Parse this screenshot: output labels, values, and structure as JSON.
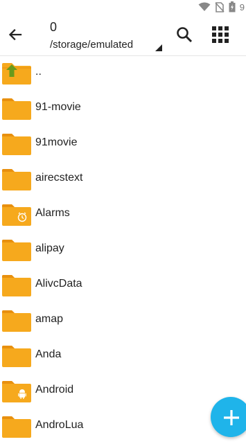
{
  "status_bar": {
    "time": "9"
  },
  "toolbar": {
    "title": "0",
    "path": "/storage/emulated"
  },
  "files": [
    {
      "name": "..",
      "icon": "folder-up-icon"
    },
    {
      "name": "91-movie",
      "icon": "folder-icon"
    },
    {
      "name": "91movie",
      "icon": "folder-icon"
    },
    {
      "name": "airecstext",
      "icon": "folder-icon"
    },
    {
      "name": "Alarms",
      "icon": "folder-alarm-icon"
    },
    {
      "name": "alipay",
      "icon": "folder-icon"
    },
    {
      "name": "AlivcData",
      "icon": "folder-icon"
    },
    {
      "name": "amap",
      "icon": "folder-icon"
    },
    {
      "name": "Anda",
      "icon": "folder-icon"
    },
    {
      "name": "Android",
      "icon": "folder-android-icon"
    },
    {
      "name": "AndroLua",
      "icon": "folder-icon"
    }
  ],
  "colors": {
    "folder": "#f6a91d",
    "folder_tab": "#e8900f",
    "up_arrow": "#6a9a1c",
    "fab": "#1fb4ea"
  }
}
